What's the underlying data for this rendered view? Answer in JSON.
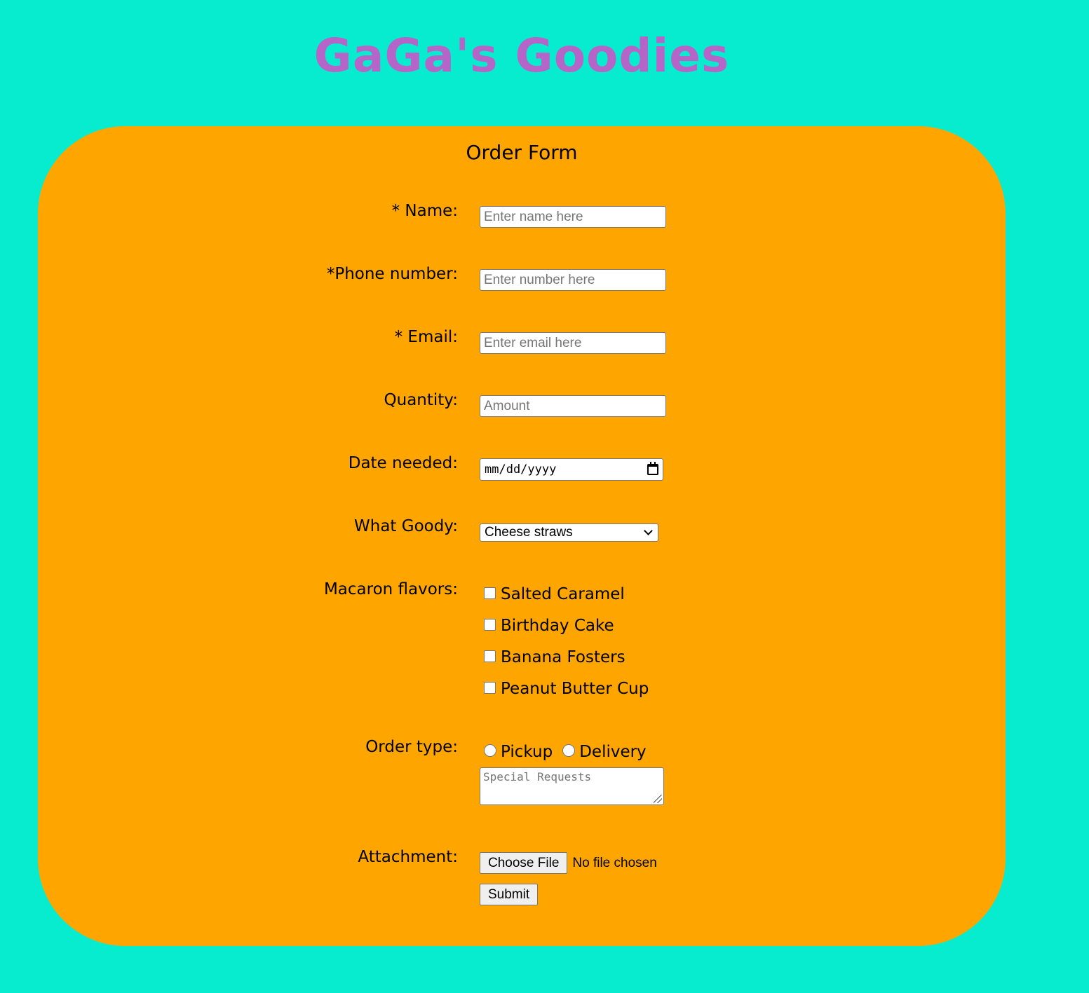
{
  "header": {
    "site_title": "GaGa's Goodies"
  },
  "form": {
    "heading": "Order Form",
    "name": {
      "label": "* Name:",
      "placeholder": "Enter name here",
      "value": ""
    },
    "phone": {
      "label": "*Phone number:",
      "placeholder": "Enter number here",
      "value": ""
    },
    "email": {
      "label": "* Email:",
      "placeholder": "Enter email here",
      "value": ""
    },
    "quantity": {
      "label": "Quantity:",
      "placeholder": "Amount",
      "value": ""
    },
    "date": {
      "label": "Date needed:",
      "display": "mm/dd/yyyy",
      "icon": "calendar-icon"
    },
    "goody": {
      "label": "What Goody:",
      "selected": "Cheese straws",
      "icon": "chevron-down-icon"
    },
    "macarons": {
      "label": "Macaron flavors:",
      "options": [
        {
          "label": "Salted Caramel",
          "checked": false
        },
        {
          "label": "Birthday Cake",
          "checked": false
        },
        {
          "label": "Banana Fosters",
          "checked": false
        },
        {
          "label": "Peanut Butter Cup",
          "checked": false
        }
      ]
    },
    "order_type": {
      "label": "Order type:",
      "options": [
        {
          "label": "Pickup",
          "selected": false
        },
        {
          "label": "Delivery",
          "selected": false
        }
      ]
    },
    "special_requests": {
      "placeholder": "Special Requests",
      "value": ""
    },
    "attachment": {
      "label": "Attachment:",
      "button": "Choose File",
      "status": "No file chosen"
    },
    "submit": {
      "label": "Submit"
    }
  },
  "colors": {
    "page_background": "#07ecce",
    "card_background": "#ffa500",
    "title_color": "#b565c8"
  }
}
